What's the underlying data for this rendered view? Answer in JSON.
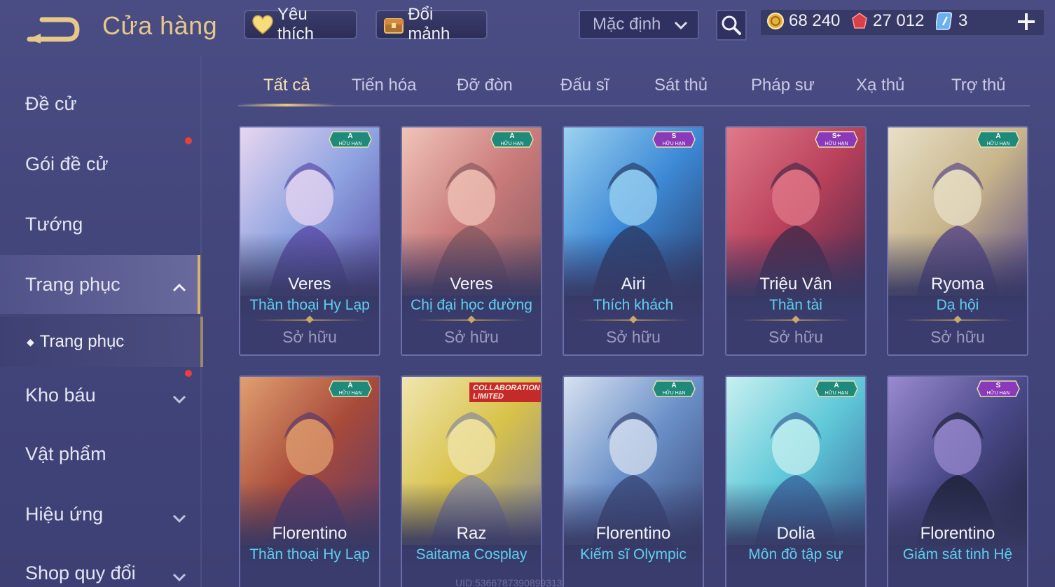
{
  "header": {
    "title": "Cửa hàng",
    "favorite_label": "Yêu thích",
    "exchange_label": "Đổi mảnh",
    "sort_value": "Mặc định",
    "currencies": {
      "gold": "68 240",
      "gems": "27 012",
      "vouchers": "3"
    }
  },
  "sidebar": {
    "items": [
      {
        "label": "Đề cử"
      },
      {
        "label": "Gói đề cử"
      },
      {
        "label": "Tướng"
      },
      {
        "label": "Trang phục"
      },
      {
        "label": "Kho báu"
      },
      {
        "label": "Vật phẩm"
      },
      {
        "label": "Hiệu ứng"
      },
      {
        "label": "Shop quy đổi"
      }
    ],
    "sub_item": "Trang phục"
  },
  "tabs": [
    "Tất cả",
    "Tiến hóa",
    "Đỡ đòn",
    "Đấu sĩ",
    "Sát thủ",
    "Pháp sư",
    "Xạ thủ",
    "Trợ thủ"
  ],
  "cards": [
    {
      "hero": "Veres",
      "skin": "Thần thoại Hy Lạp",
      "status": "Sở hữu",
      "tier": "A",
      "badge_sub": "HỮU HẠN",
      "colors": [
        "#8ea3e0",
        "#5a4fa8",
        "#e8d6f0"
      ]
    },
    {
      "hero": "Veres",
      "skin": "Chị đại học đường",
      "status": "Sở hữu",
      "tier": "A",
      "badge_sub": "HỮU HẠN",
      "colors": [
        "#c97b7a",
        "#8a5a60",
        "#f0c4b8"
      ]
    },
    {
      "hero": "Airi",
      "skin": "Thích khách",
      "status": "Sở hữu",
      "tier": "S",
      "badge_sub": "HỮU HẠN",
      "colors": [
        "#3d8ad6",
        "#2a3d6a",
        "#9bd2f0"
      ]
    },
    {
      "hero": "Triệu Vân",
      "skin": "Thần tài",
      "status": "Sở hữu",
      "tier": "S+",
      "badge_sub": "HỮU HẠN",
      "colors": [
        "#b8405a",
        "#4a2a4a",
        "#e07a8a"
      ]
    },
    {
      "hero": "Ryoma",
      "skin": "Dạ hội",
      "status": "Sở hữu",
      "tier": "A",
      "badge_sub": "HỮU HẠN",
      "colors": [
        "#c7b48a",
        "#5b4a86",
        "#e8e0c8"
      ]
    },
    {
      "hero": "Florentino",
      "skin": "Thần thoại Hy Lạp",
      "status": "",
      "tier": "A",
      "badge_sub": "HỮU HẠN",
      "colors": [
        "#a84a3a",
        "#5a3a6a",
        "#e0a070"
      ]
    },
    {
      "hero": "Raz",
      "skin": "Saitama Cosplay",
      "status": "",
      "tier": "",
      "badge_sub": "",
      "collab": "COLLABORATION LIMITED",
      "colors": [
        "#d8c24a",
        "#8a8a9a",
        "#f0e6b0"
      ]
    },
    {
      "hero": "Florentino",
      "skin": "Kiếm sĩ Olympic",
      "status": "",
      "tier": "A",
      "badge_sub": "HỮU HẠN",
      "colors": [
        "#6a90c8",
        "#3a4a7a",
        "#d8e2f0"
      ]
    },
    {
      "hero": "Dolia",
      "skin": "Môn đồ tập sự",
      "status": "",
      "tier": "A",
      "badge_sub": "HỮU HẠN",
      "colors": [
        "#5fc8d8",
        "#3a6aa0",
        "#c8f0f0"
      ]
    },
    {
      "hero": "Florentino",
      "skin": "Giám sát tinh Hệ",
      "status": "",
      "tier": "S",
      "badge_sub": "HỮU HẠN",
      "colors": [
        "#4a4a8a",
        "#20223a",
        "#9a8ad0"
      ]
    }
  ],
  "uid_text": "UID:5366787390899313"
}
